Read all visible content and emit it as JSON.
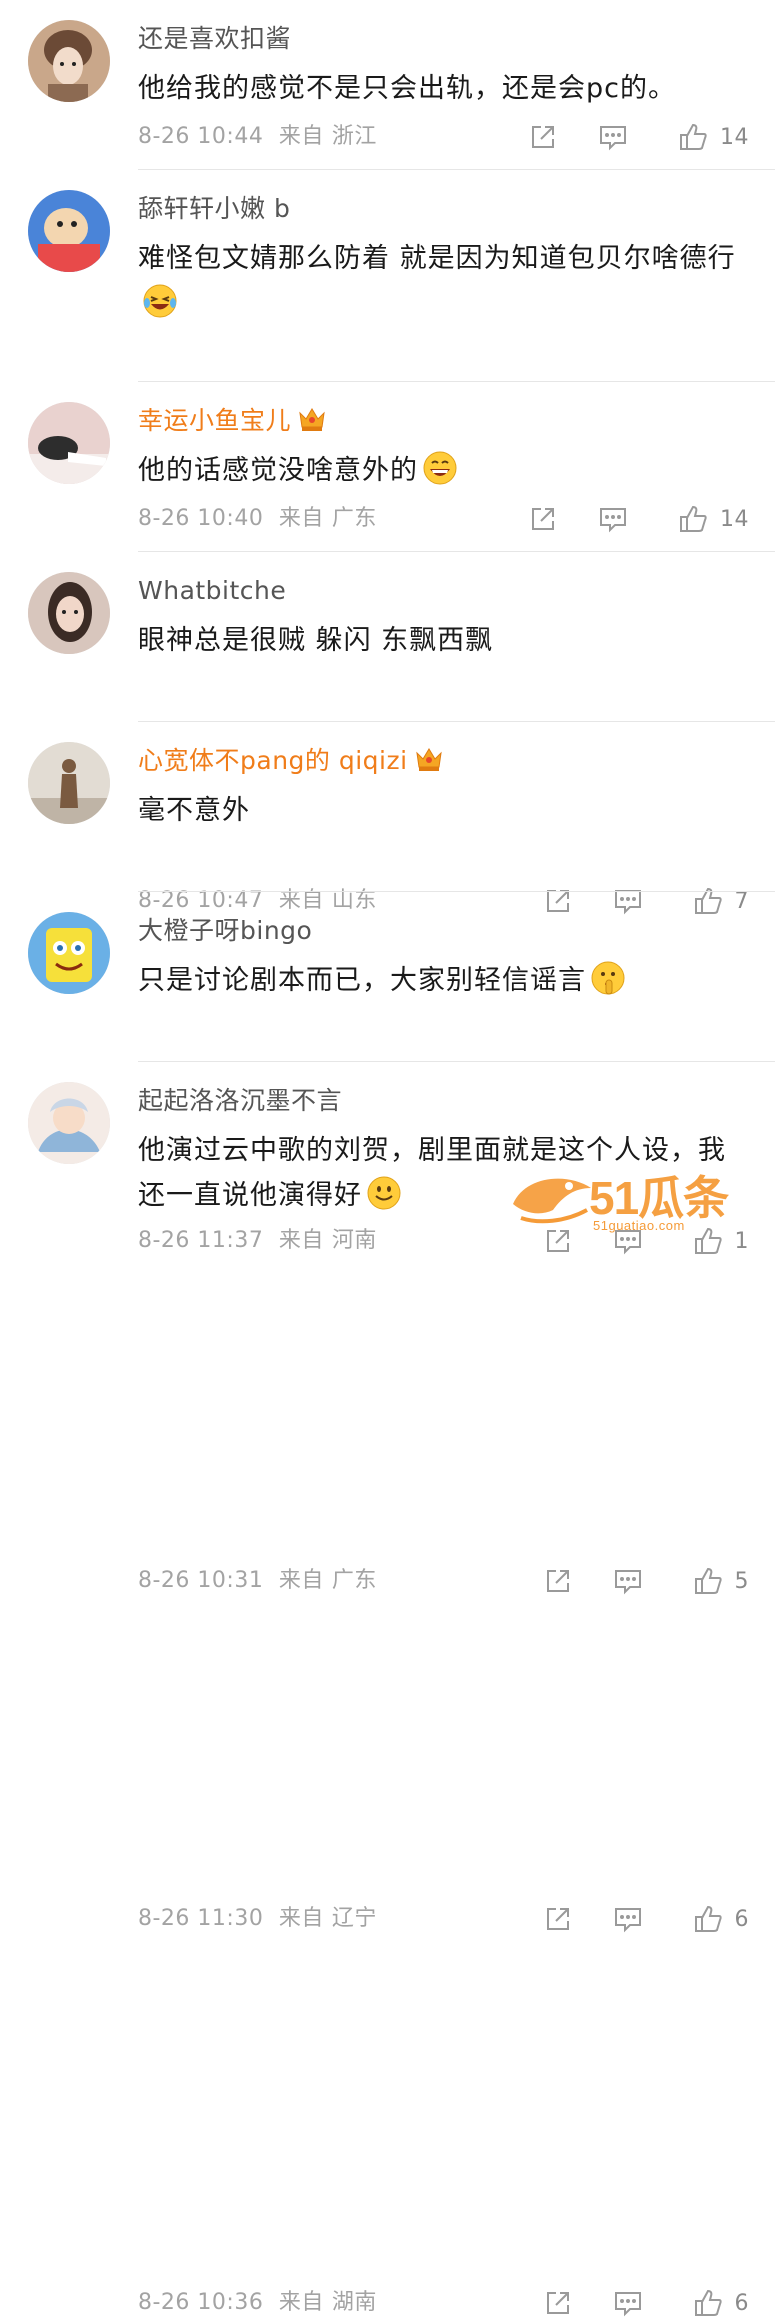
{
  "comments": [
    {
      "user": "还是喜欢扣酱",
      "vip": false,
      "text": "他给我的感觉不是只会出轨，还是会pc的。",
      "emoji": "",
      "date": "8-26 10:44",
      "source_label": "来自",
      "location": "浙江",
      "likes": "14",
      "avatar_icon": "girl-traditional-avatar",
      "avatar_colors": [
        "#c9a78a",
        "#6b4a36"
      ]
    },
    {
      "user": "舔轩轩小嫩 b",
      "vip": false,
      "text": "难怪包文婧那么防着 就是因为知道包贝尔啥德行",
      "emoji": "laughing-tears",
      "date": "8-26 10:40",
      "source_label": "来自",
      "location": "广东",
      "likes": "14",
      "avatar_icon": "cartoon-baby-avatar",
      "avatar_colors": [
        "#4a84d8",
        "#f3d6b0"
      ]
    },
    {
      "user": "幸运小鱼宝儿",
      "vip": true,
      "text": "他的话感觉没啥意外的",
      "emoji": "grinning",
      "date": "8-26 10:47",
      "source_label": "来自",
      "location": "山东",
      "likes": "7",
      "avatar_icon": "sleeping-person-avatar",
      "avatar_colors": [
        "#e9d2cf",
        "#2d2d2d"
      ]
    },
    {
      "user": "Whatbitche",
      "vip": false,
      "text": "眼神总是很贼 躲闪 东飘西飘",
      "emoji": "",
      "date": "8-26 11:37",
      "source_label": "来自",
      "location": "河南",
      "likes": "1",
      "avatar_icon": "girl-portrait-avatar",
      "avatar_colors": [
        "#d8c6bd",
        "#3b2b25"
      ]
    },
    {
      "user": "心宽体不pang的 qiqizi",
      "vip": true,
      "text": "毫不意外",
      "emoji": "",
      "date": "8-26 10:31",
      "source_label": "来自",
      "location": "广东",
      "likes": "5",
      "avatar_icon": "figurine-avatar",
      "avatar_colors": [
        "#e2dcd3",
        "#7a5a40"
      ]
    },
    {
      "user": "大橙子呀bingo",
      "vip": false,
      "text": "只是讨论剧本而已，大家别轻信谣言",
      "emoji": "thinking-shush",
      "date": "8-26 11:30",
      "source_label": "来自",
      "location": "辽宁",
      "likes": "6",
      "avatar_icon": "spongebob-avatar",
      "avatar_colors": [
        "#f6e03a",
        "#6ab0e6"
      ]
    },
    {
      "user": "起起洛洛沉墨不言",
      "vip": false,
      "text": "他演过云中歌的刘贺，剧里面就是这个人设，我还一直说他演得好",
      "emoji": "smile",
      "date": "8-26 10:36",
      "source_label": "来自",
      "location": "湖南",
      "likes": "6",
      "avatar_icon": "anime-character-avatar",
      "avatar_colors": [
        "#f4ebe6",
        "#8fb5d9"
      ]
    }
  ],
  "watermark": {
    "text": "51瓜条",
    "url": "51guatiao.com"
  },
  "colors": {
    "vip_name": "#f07d1a",
    "name": "#555555",
    "meta": "#a3a3a3",
    "icon": "#9a9a9a"
  }
}
